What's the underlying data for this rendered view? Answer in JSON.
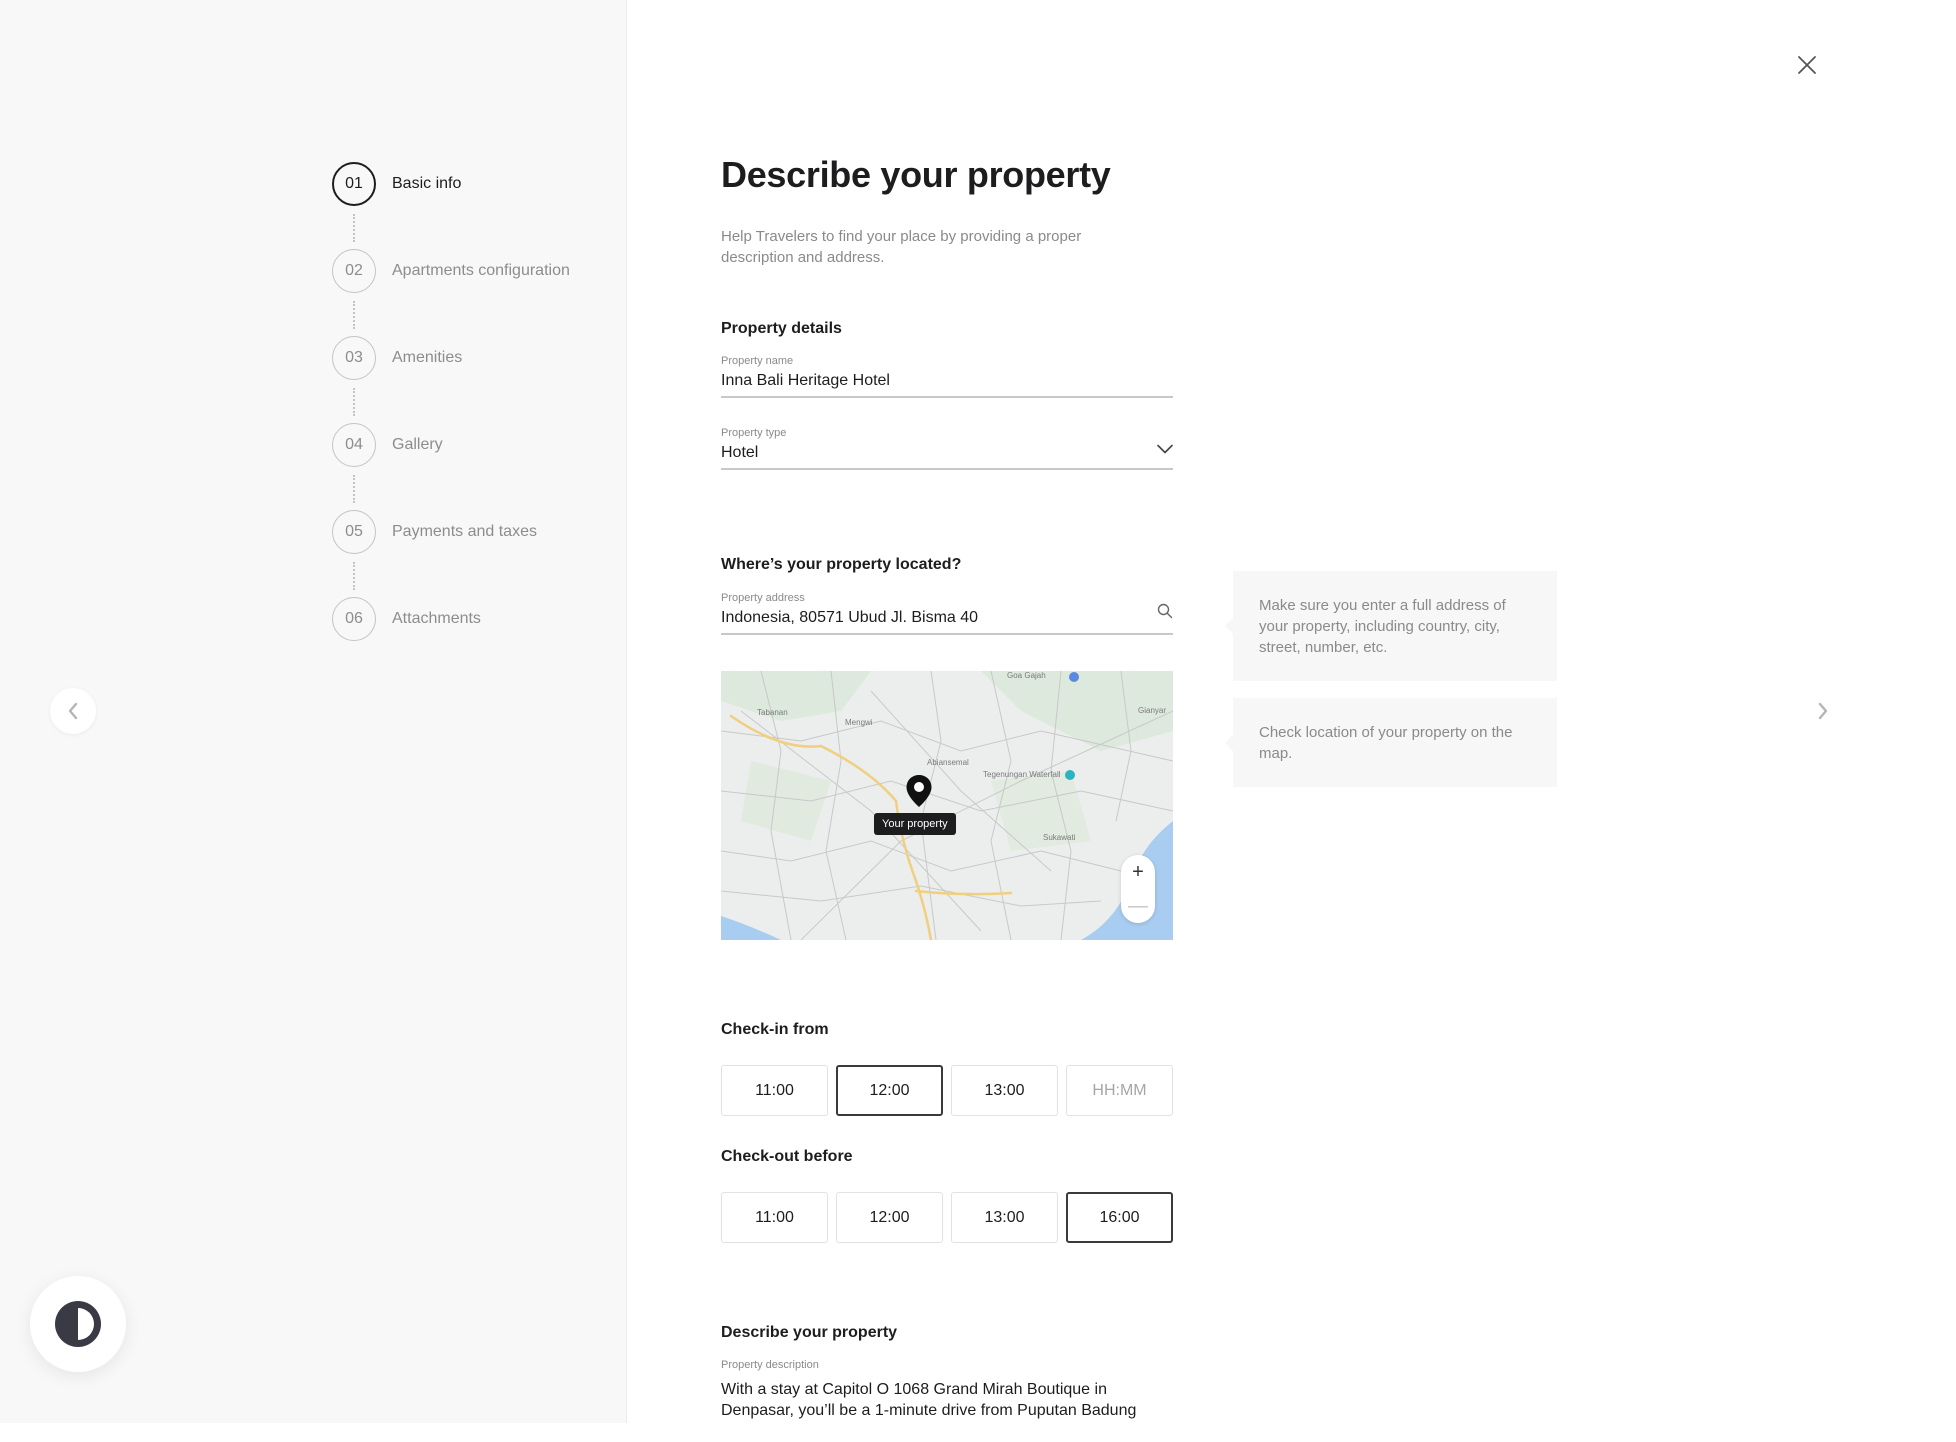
{
  "stepper": {
    "steps": [
      {
        "number": "01",
        "label": "Basic info",
        "active": true
      },
      {
        "number": "02",
        "label": "Apartments configuration",
        "active": false
      },
      {
        "number": "03",
        "label": "Amenities",
        "active": false
      },
      {
        "number": "04",
        "label": "Gallery",
        "active": false
      },
      {
        "number": "05",
        "label": "Payments and taxes",
        "active": false
      },
      {
        "number": "06",
        "label": "Attachments",
        "active": false
      }
    ]
  },
  "page": {
    "title": "Describe your property",
    "subtitle": "Help Travelers to find your place by providing a proper description and address."
  },
  "property_details": {
    "heading": "Property details",
    "name_label": "Property name",
    "name_value": "Inna Bali Heritage Hotel",
    "type_label": "Property type",
    "type_value": "Hotel"
  },
  "location": {
    "heading": "Where’s your property located?",
    "address_label": "Property address",
    "address_value": "Indonesia, 80571 Ubud Jl. Bisma 40",
    "map": {
      "pin_label": "Your property",
      "places": [
        "Goa Gajah",
        "Tabanan",
        "Mengwi",
        "Gianyar",
        "Abiansemal",
        "Tegenungan Waterfall",
        "Sukawati"
      ],
      "zoom_in": "+",
      "zoom_out": "—"
    }
  },
  "hints": {
    "address": "Make sure you enter a full address of your property, including country, city, street, number, etc.",
    "map": "Check location of your property on the map."
  },
  "checkin": {
    "heading": "Check-in from",
    "options": [
      "11:00",
      "12:00",
      "13:00",
      "HH:MM"
    ],
    "selected": "12:00"
  },
  "checkout": {
    "heading": "Check-out before",
    "options": [
      "11:00",
      "12:00",
      "13:00",
      "16:00"
    ],
    "selected": "16:00"
  },
  "description": {
    "heading": "Describe your property",
    "label": "Property description",
    "value": "With a stay at Capitol O 1068 Grand Mirah Boutique in Denpasar, you’ll be a 1-minute drive from Puputan Badung"
  },
  "icons": {
    "close": "close-icon",
    "prev": "chevron-left-icon",
    "next": "chevron-right-icon",
    "theme": "contrast-icon",
    "dropdown": "chevron-down-icon",
    "search": "search-icon",
    "pin": "map-pin-icon"
  }
}
